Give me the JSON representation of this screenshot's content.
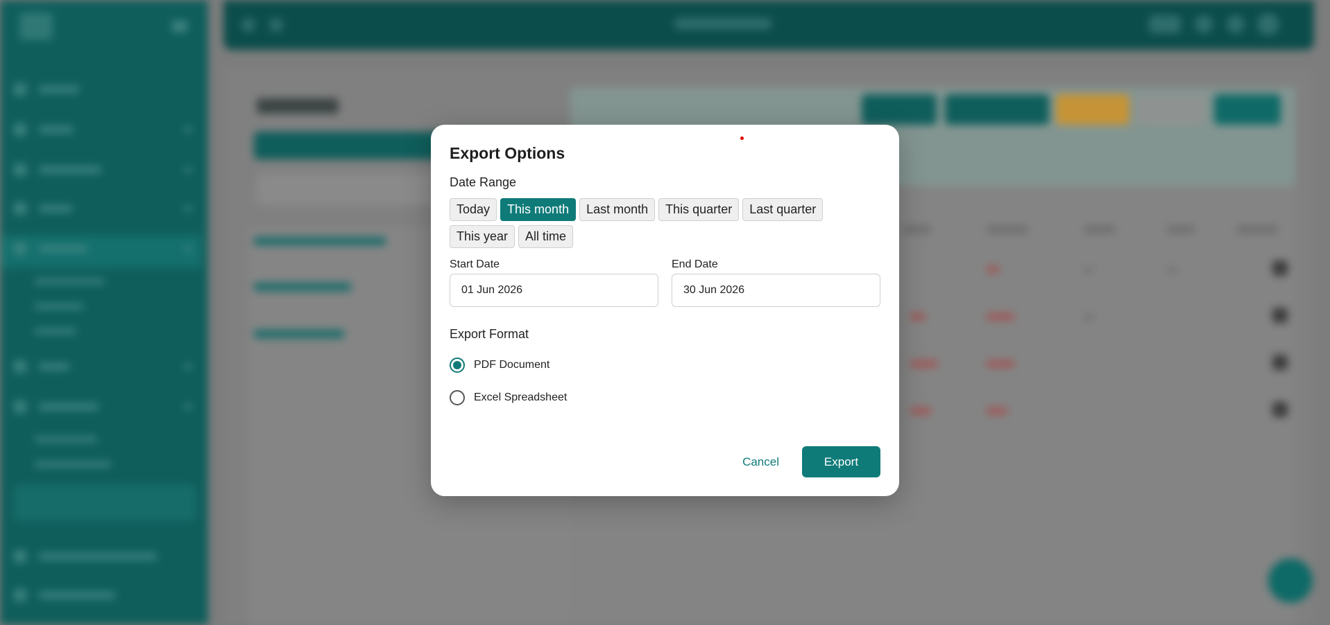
{
  "dialog": {
    "title": "Export Options",
    "date_range_label": "Date Range",
    "date_presets": [
      {
        "label": "Today",
        "selected": false
      },
      {
        "label": "This month",
        "selected": true
      },
      {
        "label": "Last month",
        "selected": false
      },
      {
        "label": "This quarter",
        "selected": false
      },
      {
        "label": "Last quarter",
        "selected": false
      },
      {
        "label": "This year",
        "selected": false
      },
      {
        "label": "All time",
        "selected": false
      }
    ],
    "start_date": {
      "label": "Start Date",
      "value": "01 Jun 2026"
    },
    "end_date": {
      "label": "End Date",
      "value": "30 Jun 2026"
    },
    "export_format_label": "Export Format",
    "formats": [
      {
        "label": "PDF Document",
        "selected": true
      },
      {
        "label": "Excel Spreadsheet",
        "selected": false
      }
    ],
    "cancel_label": "Cancel",
    "export_label": "Export"
  },
  "colors": {
    "accent": "#0f7b79",
    "sidebar": "#0f5e5c",
    "topbar": "#0b4d4b",
    "backdrop": "#7d7d7d"
  }
}
